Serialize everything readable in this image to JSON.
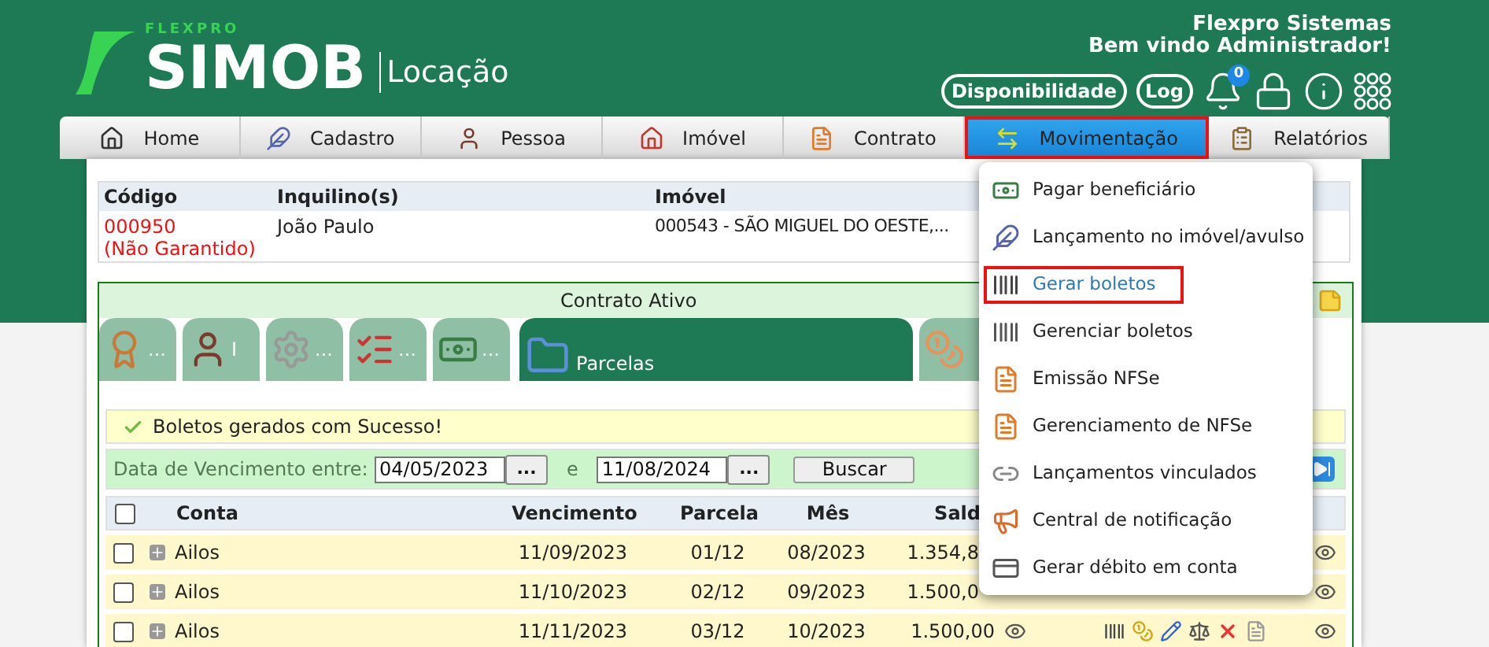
{
  "header": {
    "brand_small": "FLEXPRO",
    "brand": "SIMOB",
    "product": "Locação",
    "company": "Flexpro Sistemas",
    "welcome": "Bem vindo Administrador!",
    "buttons": [
      "Disponibilidade",
      "Log"
    ],
    "notification_count": "0"
  },
  "nav": [
    {
      "label": "Home",
      "selected": false
    },
    {
      "label": "Cadastro",
      "selected": false
    },
    {
      "label": "Pessoa",
      "selected": false
    },
    {
      "label": "Imóvel",
      "selected": false
    },
    {
      "label": "Contrato",
      "selected": false
    },
    {
      "label": "Movimentação",
      "selected": true
    },
    {
      "label": "Relatórios",
      "selected": false
    }
  ],
  "contract": {
    "columns": [
      "Código",
      "Inquilino(s)",
      "Imóvel"
    ],
    "code": "000950",
    "guarantee": "(Não Garantido)",
    "tenant": "João Paulo",
    "property": "000543 - SÃO MIGUEL DO OESTE,..."
  },
  "panel": {
    "title": "Contrato Ativo",
    "tabs": [
      {
        "label": "...",
        "selected": false
      },
      {
        "label": "I",
        "selected": false
      },
      {
        "label": "...",
        "selected": false
      },
      {
        "label": "...",
        "selected": false
      },
      {
        "label": "...",
        "selected": false
      },
      {
        "label": "Parcelas",
        "selected": true
      },
      {
        "selected": false
      }
    ],
    "message": "Boletos gerados com Sucesso!",
    "filter": {
      "label": "Data de Vencimento entre:",
      "from": "04/05/2023",
      "pick": "...",
      "separator": "e",
      "to": "11/08/2024",
      "pick2": "...",
      "search": "Buscar"
    },
    "table": {
      "all_checked": false,
      "columns": [
        "Conta",
        "Vencimento",
        "Parcela",
        "Mês",
        "Sald"
      ],
      "rows": [
        {
          "conta": "Ailos",
          "vencimento": "11/09/2023",
          "parcela": "01/12",
          "mes": "08/2023",
          "saldo": "1.354,8",
          "checked": false,
          "icons_shown": false
        },
        {
          "conta": "Ailos",
          "vencimento": "11/10/2023",
          "parcela": "02/12",
          "mes": "09/2023",
          "saldo": "1.500,0",
          "checked": false,
          "icons_shown": false
        },
        {
          "conta": "Ailos",
          "vencimento": "11/11/2023",
          "parcela": "03/12",
          "mes": "10/2023",
          "saldo": "1.500,00",
          "checked": false,
          "icons_shown": true
        }
      ]
    }
  },
  "menu": [
    {
      "label": "Pagar beneficiário",
      "selected": false
    },
    {
      "label": "Lançamento no imóvel/avulso",
      "selected": false
    },
    {
      "label": "Gerar boletos",
      "selected": true
    },
    {
      "label": "Gerenciar boletos",
      "selected": false
    },
    {
      "label": "Emissão NFSe",
      "selected": false
    },
    {
      "label": "Gerenciamento de NFSe",
      "selected": false
    },
    {
      "label": "Lançamentos vinculados",
      "selected": false
    },
    {
      "label": "Central de notificação",
      "selected": false
    },
    {
      "label": "Gerar débito em conta",
      "selected": false
    }
  ]
}
